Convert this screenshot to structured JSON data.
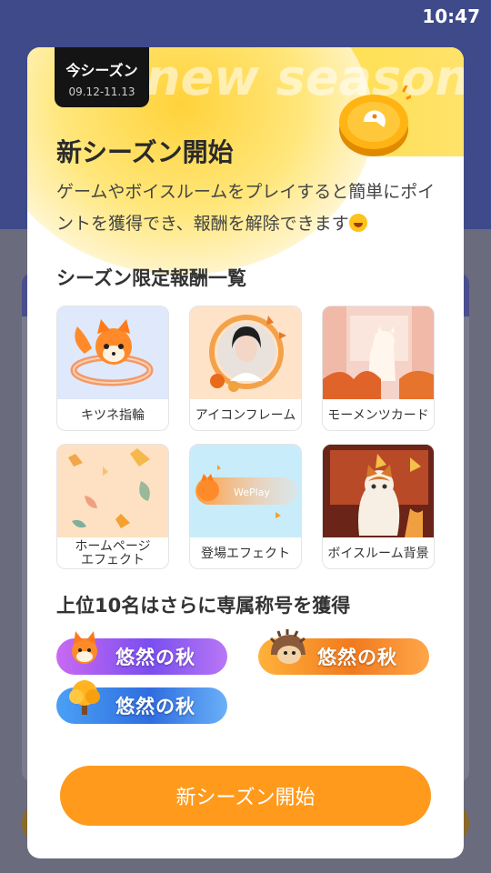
{
  "status_bar": {
    "time": "10:47"
  },
  "modal": {
    "season_tag": {
      "label": "今シーズン",
      "dates": "09.12-11.13"
    },
    "watermark": "new season",
    "title": "新シーズン開始",
    "description": "ゲームやボイスルームをプレイすると簡単にポイントを獲得でき、報酬を解除できます",
    "rewards_title": "シーズン限定報酬一覧",
    "rewards": [
      {
        "label": "キツネ指輪",
        "icon": "fox-ring-icon"
      },
      {
        "label": "アイコンフレーム",
        "icon": "avatar-frame-icon"
      },
      {
        "label": "モーメンツカード",
        "icon": "moments-card-icon"
      },
      {
        "label": "ホームページ\nエフェクト",
        "icon": "homepage-effect-icon"
      },
      {
        "label": "登場エフェクト",
        "icon": "entrance-effect-icon",
        "inner_text": "WePlay"
      },
      {
        "label": "ボイスルーム背景",
        "icon": "voice-room-bg-icon"
      }
    ],
    "top10_title": "上位10名はさらに専属称号を獲得",
    "badges": [
      {
        "label": "悠然の秋",
        "icon": "fox-icon",
        "color": "#8a5cf0"
      },
      {
        "label": "悠然の秋",
        "icon": "hedgehog-icon",
        "color": "#f27a1e"
      },
      {
        "label": "悠然の秋",
        "icon": "tree-icon",
        "color": "#3a7be8"
      }
    ],
    "start_button": "新シーズン開始"
  }
}
